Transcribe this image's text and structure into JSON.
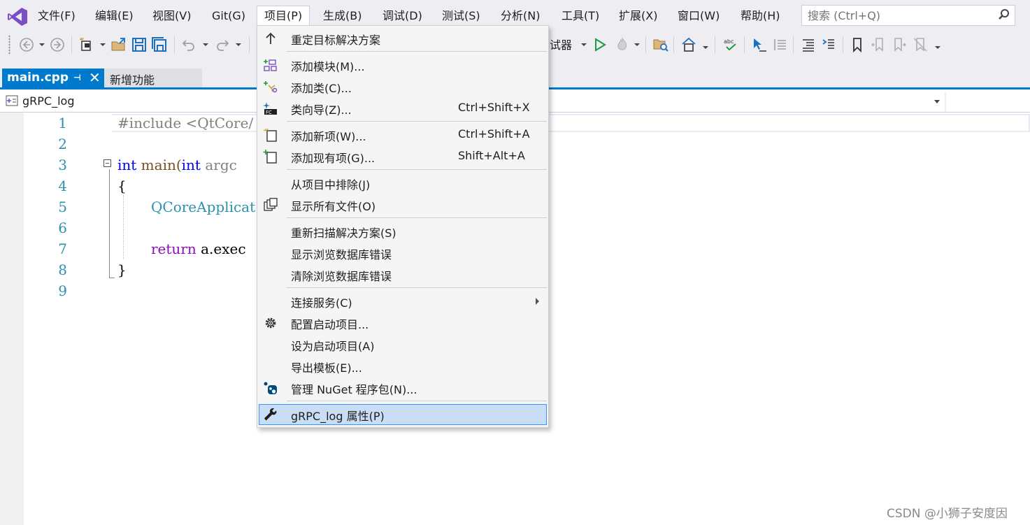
{
  "menubar": {
    "logo_icon": "visual-studio-logo-icon",
    "items": [
      {
        "label": "文件(F)"
      },
      {
        "label": "编辑(E)"
      },
      {
        "label": "视图(V)"
      },
      {
        "label": "Git(G)"
      },
      {
        "label": "项目(P)"
      },
      {
        "label": "生成(B)"
      },
      {
        "label": "调试(D)"
      },
      {
        "label": "测试(S)"
      },
      {
        "label": "分析(N)"
      },
      {
        "label": "工具(T)"
      },
      {
        "label": "扩展(X)"
      },
      {
        "label": "窗口(W)"
      },
      {
        "label": "帮助(H)"
      }
    ],
    "search_placeholder": "搜索 (Ctrl+Q)"
  },
  "toolbar": {
    "debugger_label": "试器",
    "icons": [
      "back-icon",
      "forward-icon",
      "new-project-icon",
      "open-icon",
      "save-icon",
      "save-all-icon",
      "undo-icon",
      "redo-icon",
      "start-icon",
      "hot-reload-icon",
      "solution-explorer-icon",
      "home-icon",
      "spell-check-icon",
      "cursor-icon",
      "indent-icon",
      "format-icon",
      "wrap-icon",
      "bookmark-icon"
    ]
  },
  "tabs": {
    "active": {
      "label": "main.cpp",
      "pin": "⊣",
      "close": "✕"
    },
    "second": {
      "label": "新增功能"
    }
  },
  "navbar": {
    "project": "gRPC_log"
  },
  "editor": {
    "lines": [
      "1",
      "2",
      "3",
      "4",
      "5",
      "6",
      "7",
      "8",
      "9"
    ],
    "code": {
      "l1_pp": "#include",
      "l1_inc": " <QtCore/",
      "l3_kw1": "int",
      "l3_fn": " main(",
      "l3_kw2": "int",
      "l3_rest": " argc",
      "l4": "{",
      "l5": "QCoreApplicat",
      "l7_kw": "return",
      "l7_rest": " a.exec",
      "l8": "}"
    }
  },
  "dropdown": {
    "items": [
      {
        "label": "重定目标解决方案",
        "shortcut": "",
        "icon": "retarget-arrow-icon"
      },
      {
        "label": "添加模块(M)...",
        "shortcut": "",
        "icon": "add-module-icon"
      },
      {
        "label": "添加类(C)...",
        "shortcut": "",
        "icon": "add-class-icon"
      },
      {
        "label": "类向导(Z)...",
        "shortcut": "Ctrl+Shift+X",
        "icon": "class-wizard-icon"
      },
      {
        "label": "添加新项(W)...",
        "shortcut": "Ctrl+Shift+A",
        "icon": "add-new-item-icon"
      },
      {
        "label": "添加现有项(G)...",
        "shortcut": "Shift+Alt+A",
        "icon": "add-existing-item-icon"
      },
      {
        "label": "从项目中排除(J)",
        "shortcut": "",
        "icon": ""
      },
      {
        "label": "显示所有文件(O)",
        "shortcut": "",
        "icon": "show-all-files-icon"
      },
      {
        "label": "重新扫描解决方案(S)",
        "shortcut": "",
        "icon": ""
      },
      {
        "label": "显示浏览数据库错误",
        "shortcut": "",
        "icon": ""
      },
      {
        "label": "清除浏览数据库错误",
        "shortcut": "",
        "icon": ""
      },
      {
        "label": "连接服务(C)",
        "shortcut": "",
        "icon": "",
        "submenu": true
      },
      {
        "label": "配置启动项目...",
        "shortcut": "",
        "icon": "gear-icon"
      },
      {
        "label": "设为启动项目(A)",
        "shortcut": "",
        "icon": ""
      },
      {
        "label": "导出模板(E)...",
        "shortcut": "",
        "icon": ""
      },
      {
        "label": "管理 NuGet 程序包(N)...",
        "shortcut": "",
        "icon": "nuget-icon"
      },
      {
        "label": "gRPC_log 属性(P)",
        "shortcut": "",
        "icon": "wrench-icon",
        "highlighted": true
      }
    ]
  },
  "watermark": "CSDN @小狮子安度因",
  "colors": {
    "accent": "#007acc",
    "menu_bg": "#eeeef2",
    "highlight": "#c9def5",
    "keyword": "#0000ff",
    "line_number": "#2b91af"
  }
}
